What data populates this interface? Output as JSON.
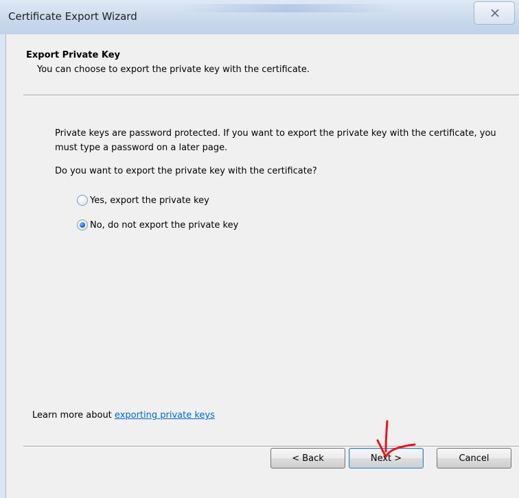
{
  "window": {
    "title": "Certificate Export Wizard",
    "close_icon": "close-x-icon"
  },
  "header": {
    "title": "Export Private Key",
    "subtitle": "You can choose to export the private key with the certificate."
  },
  "body": {
    "description": "Private keys are password protected. If you want to export the private key with the certificate, you must type a password on a later page.",
    "question": "Do you want to export the private key with the certificate?",
    "options": [
      {
        "label": "Yes, export the private key",
        "selected": false
      },
      {
        "label": "No, do not export the private key",
        "selected": true
      }
    ]
  },
  "learn_more": {
    "prefix": "Learn more about ",
    "link": "exporting private keys"
  },
  "buttons": {
    "back": "< Back",
    "next": "Next >",
    "cancel": "Cancel"
  },
  "annotation": {
    "color": "#e8141b",
    "icon": "hand-drawn-arrow-down-icon"
  }
}
